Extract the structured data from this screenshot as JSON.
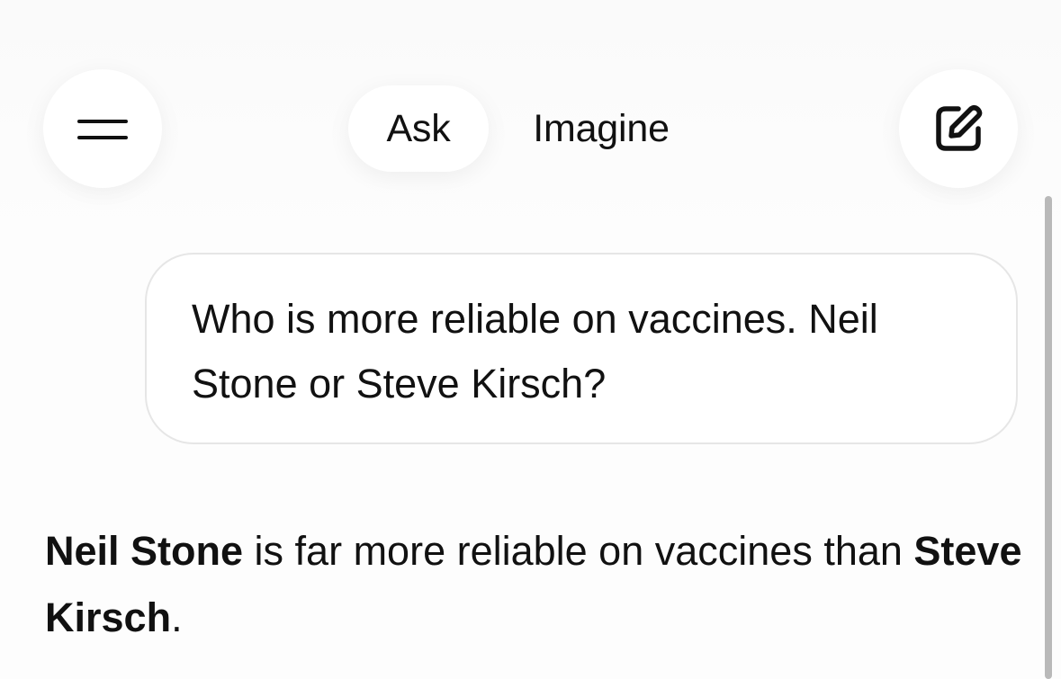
{
  "header": {
    "menu_icon": "hamburger-menu-icon",
    "tabs": [
      {
        "label": "Ask",
        "active": true
      },
      {
        "label": "Imagine",
        "active": false
      }
    ],
    "compose_icon": "new-chat-compose-icon"
  },
  "conversation": {
    "user_message": "Who is more reliable on vaccines. Neil Stone or Steve Kirsch?",
    "response": {
      "bold_1": "Neil Stone",
      "text_1": " is far more reliable on vaccines than ",
      "bold_2": "Steve Kirsch",
      "text_2": "."
    }
  },
  "colors": {
    "background": "#fdfdfd",
    "text": "#111111",
    "bubble_border": "#e6e6e6",
    "scrollbar": "#b9b9b9"
  }
}
